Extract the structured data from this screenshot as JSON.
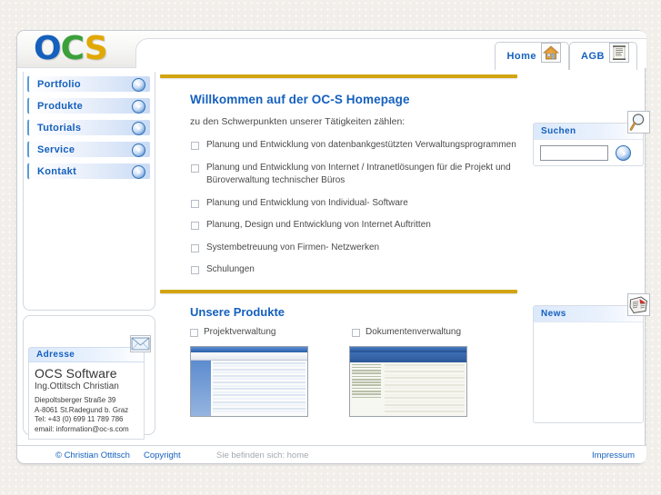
{
  "logo": {
    "part1": "O",
    "part2": "C",
    "part3": "S"
  },
  "tabs": [
    {
      "label": "Home",
      "icon": "house-icon"
    },
    {
      "label": "AGB",
      "icon": "document-scroll-icon"
    }
  ],
  "sidebar": {
    "menu_items": [
      {
        "label": "Portfolio",
        "arrow": "chevron-down-icon"
      },
      {
        "label": "Produkte",
        "arrow": "chevron-down-icon"
      },
      {
        "label": "Tutorials",
        "arrow": "chevron-down-icon"
      },
      {
        "label": "Service",
        "arrow": "chevron-down-icon"
      },
      {
        "label": "Kontakt",
        "arrow": "chevron-right-icon"
      }
    ],
    "address": {
      "head": "Adresse",
      "icon": "envelope-icon",
      "company": "OCS Software",
      "person": "Ing.Ottitsch Christian",
      "lines": [
        "Diepoltsberger Straße 39",
        "A-8061 St.Radegund b. Graz",
        "Tel: +43 (0) 699 11 789 786",
        "email: information@oc-s.com"
      ]
    }
  },
  "main": {
    "welcome_title": "Willkommen auf der OC-S Homepage",
    "welcome_subtitle": "zu den Schwerpunkten unserer Tätigkeiten zählen:",
    "services": [
      "Planung und Entwicklung von datenbankgestützten Verwaltungsprogrammen",
      "Planung und Entwicklung von Internet / Intranetlösungen für die Projekt und Büroverwaltung technischer Büros",
      "Planung und Entwicklung von Individual- Software",
      "Planung, Design und Entwicklung von Internet Auftritten",
      "Systembetreuung von Firmen- Netzwerken",
      "Schulungen"
    ],
    "products_title": "Unsere Produkte",
    "products": [
      {
        "label": "Projektverwaltung"
      },
      {
        "label": "Dokumentenverwaltung"
      }
    ]
  },
  "right": {
    "search": {
      "head": "Suchen",
      "icon": "magnifier-icon",
      "value": "",
      "placeholder": "",
      "go_icon": "arrow-right-circle-icon"
    },
    "news": {
      "head": "News",
      "icon": "newspaper-icon",
      "body": ""
    }
  },
  "footer": {
    "copyright_owner": "© Christian Ottitsch",
    "copyright_link": "Copyright",
    "breadcrumb": "Sie befinden sich: home",
    "impressum": "Impressum"
  },
  "colors": {
    "brand_blue": "#1560bd",
    "brand_green": "#3aa03a",
    "brand_gold": "#e0a800",
    "rule_gold": "#d3a411",
    "page_bg": "#f2efeb"
  }
}
